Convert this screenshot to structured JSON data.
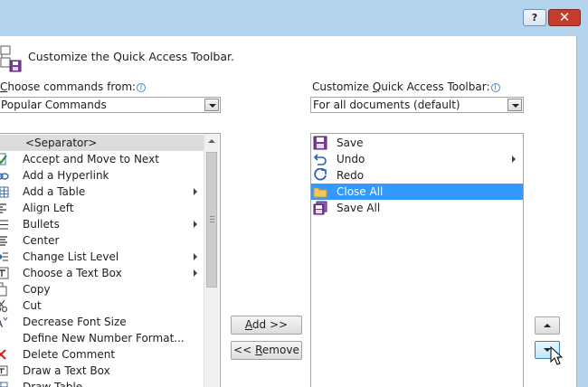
{
  "window": {
    "help_glyph": "?",
    "close_glyph": "✕",
    "accent": "#b4d4ee"
  },
  "header": {
    "title": "Customize the Quick Access Toolbar."
  },
  "left": {
    "choose_label_pre": "",
    "choose_label_hot": "C",
    "choose_label_post": "hoose commands from:",
    "choose_value": "Popular Commands",
    "items": [
      {
        "label": "<Separator>",
        "icon": "separator",
        "separator": true,
        "submenu": false
      },
      {
        "label": "Accept and Move to Next",
        "icon": "accept-icon",
        "submenu": false
      },
      {
        "label": "Add a Hyperlink",
        "icon": "hyperlink-icon",
        "submenu": false
      },
      {
        "label": "Add a Table",
        "icon": "table-icon",
        "submenu": true
      },
      {
        "label": "Align Left",
        "icon": "align-left-icon",
        "submenu": false
      },
      {
        "label": "Bullets",
        "icon": "bullets-icon",
        "submenu": true
      },
      {
        "label": "Center",
        "icon": "center-icon",
        "submenu": false
      },
      {
        "label": "Change List Level",
        "icon": "list-level-icon",
        "submenu": true
      },
      {
        "label": "Choose a Text Box",
        "icon": "text-box-icon",
        "submenu": true
      },
      {
        "label": "Copy",
        "icon": "copy-icon",
        "submenu": false
      },
      {
        "label": "Cut",
        "icon": "cut-icon",
        "submenu": false
      },
      {
        "label": "Decrease Font Size",
        "icon": "decrease-font-icon",
        "submenu": false
      },
      {
        "label": "Define New Number Format...",
        "icon": "",
        "submenu": false
      },
      {
        "label": "Delete Comment",
        "icon": "delete-comment-icon",
        "submenu": false
      },
      {
        "label": "Draw a Text Box",
        "icon": "draw-text-box-icon",
        "submenu": false
      },
      {
        "label": "Draw Table",
        "icon": "draw-table-icon",
        "submenu": false
      }
    ]
  },
  "right": {
    "toolbar_label_pre": "Customize ",
    "toolbar_label_hot": "Q",
    "toolbar_label_post": "uick Access Toolbar:",
    "toolbar_value": "For all documents (default)",
    "items": [
      {
        "label": "Save",
        "icon": "save-icon",
        "selected": false,
        "submenu": false
      },
      {
        "label": "Undo",
        "icon": "undo-icon",
        "selected": false,
        "submenu": true
      },
      {
        "label": "Redo",
        "icon": "redo-icon",
        "selected": false,
        "submenu": false
      },
      {
        "label": "Close All",
        "icon": "folder-icon",
        "selected": true,
        "submenu": false
      },
      {
        "label": "Save All",
        "icon": "save-all-icon",
        "selected": false,
        "submenu": false
      }
    ]
  },
  "buttons": {
    "add_hot": "A",
    "add_rest": "dd >>",
    "remove_pre": "<< ",
    "remove_hot": "R",
    "remove_rest": "emove"
  },
  "info_glyph": "i",
  "selection_color": "#3399ff"
}
